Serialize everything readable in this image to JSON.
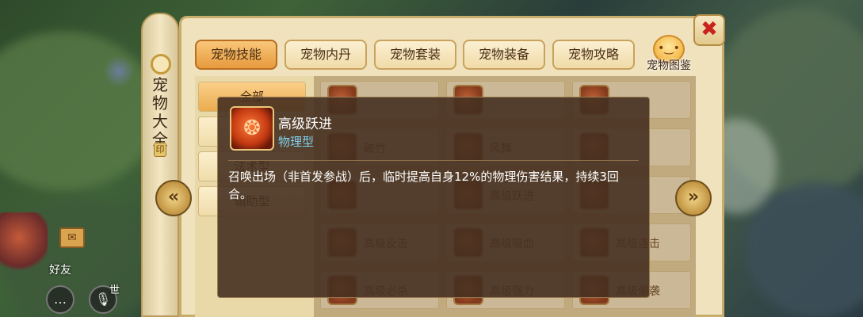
{
  "window": {
    "scroll_title": "宠物大全",
    "close_symbol": "✖"
  },
  "tabs": [
    {
      "label": "宠物技能",
      "active": true
    },
    {
      "label": "宠物内丹",
      "active": false
    },
    {
      "label": "宠物套装",
      "active": false
    },
    {
      "label": "宠物装备",
      "active": false
    },
    {
      "label": "宠物攻略",
      "active": false
    }
  ],
  "pet_guide": {
    "label": "宠物图鉴",
    "icon": "pet-face-icon"
  },
  "categories": [
    {
      "label": "全部",
      "active": true
    },
    {
      "label": "",
      "active": false
    },
    {
      "label": "法术型",
      "active": false
    },
    {
      "label": "辅助型",
      "active": false
    }
  ],
  "skills": [
    [
      "",
      "",
      ""
    ],
    [
      "破竹",
      "风舞",
      ""
    ],
    [
      "",
      "高级跃进",
      ""
    ],
    [
      "高级反击",
      "高级吸血",
      "高级连击"
    ],
    [
      "高级必杀",
      "高级强力",
      "高级偷袭"
    ]
  ],
  "tooltip": {
    "name": "高级跃进",
    "type": "物理型",
    "description": "召唤出场（非首发参战）后，临时提高自身12%的物理伤害结果，持续3回合。",
    "icon": "advanced-leap-skill-icon"
  },
  "hud": {
    "friend_label": "好友",
    "world_label": "世",
    "chat_icon": "chat-bubble-icon",
    "voice_icon": "microphone-icon",
    "mail_icon": "mail-icon"
  },
  "colors": {
    "tooltip_type": "#7fd2f0",
    "active_tab": "#e79a3d",
    "close_x": "#c8231c"
  }
}
